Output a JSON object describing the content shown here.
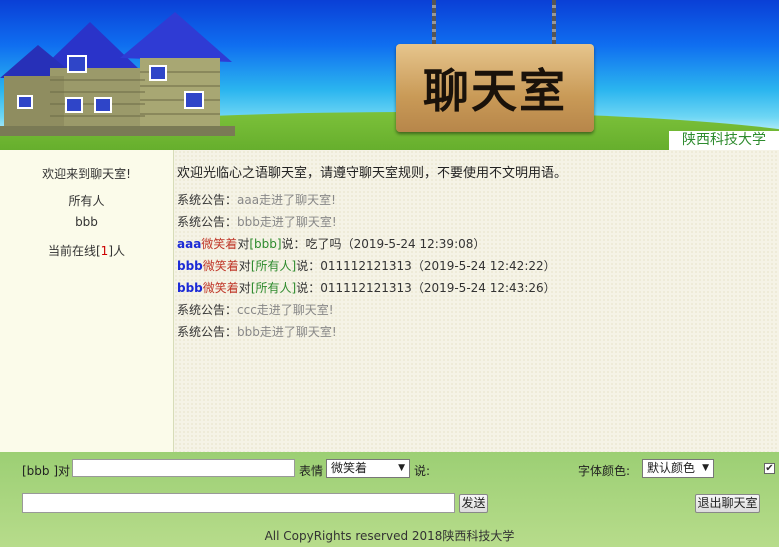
{
  "header": {
    "sign_text": "聊天室",
    "school": "陕西科技大学"
  },
  "sidebar": {
    "welcome": "欢迎来到聊天室!",
    "users": [
      "所有人",
      "bbb"
    ],
    "online_prefix": "当前在线[",
    "online_count": "1",
    "online_suffix": "]人"
  },
  "chat": {
    "welcome": "欢迎光临心之语聊天室，请遵守聊天室规则，不要使用不文明用语。",
    "messages": [
      {
        "type": "system",
        "label": "系统公告：",
        "text": "aaa走进了聊天室!"
      },
      {
        "type": "system",
        "label": "系统公告：",
        "text": "bbb走进了聊天室!"
      },
      {
        "type": "chat",
        "sender": "aaa",
        "emote": "微笑着",
        "dui": "对",
        "target": "[bbb]",
        "say": "说：吃了吗",
        "time": "（2019-5-24 12:39:08）"
      },
      {
        "type": "chat",
        "sender": "bbb",
        "emote": "微笑着",
        "dui": "对",
        "target": "[所有人]",
        "say": "说：011112121313",
        "time": "（2019-5-24 12:42:22）"
      },
      {
        "type": "chat",
        "sender": "bbb",
        "emote": "微笑着",
        "dui": "对",
        "target": "[所有人]",
        "say": "说：011112121313",
        "time": "（2019-5-24 12:43:26）"
      },
      {
        "type": "system",
        "label": "系统公告：",
        "text": "ccc走进了聊天室!"
      },
      {
        "type": "system",
        "label": "系统公告：",
        "text": "bbb走进了聊天室!"
      }
    ]
  },
  "form": {
    "user_prefix": "[bbb ]对",
    "target_value": "",
    "emote_label": "表情",
    "emote_selected": "微笑着",
    "say_label": "说:",
    "color_label": "字体颜色:",
    "color_selected": "默认颜色",
    "checkbox_checked": true,
    "message_value": "",
    "send_label": "发送",
    "exit_label": "退出聊天室"
  },
  "footer": {
    "copyright": "All CopyRights reserved 2018陕西科技大学"
  },
  "colors": {
    "sender": "#1c2bd6",
    "emote": "#c0392b",
    "target": "#2e8b2e",
    "system_text": "#888888"
  },
  "icons": {
    "dropdown": "chevron-down-icon",
    "checkbox": "check-icon"
  }
}
